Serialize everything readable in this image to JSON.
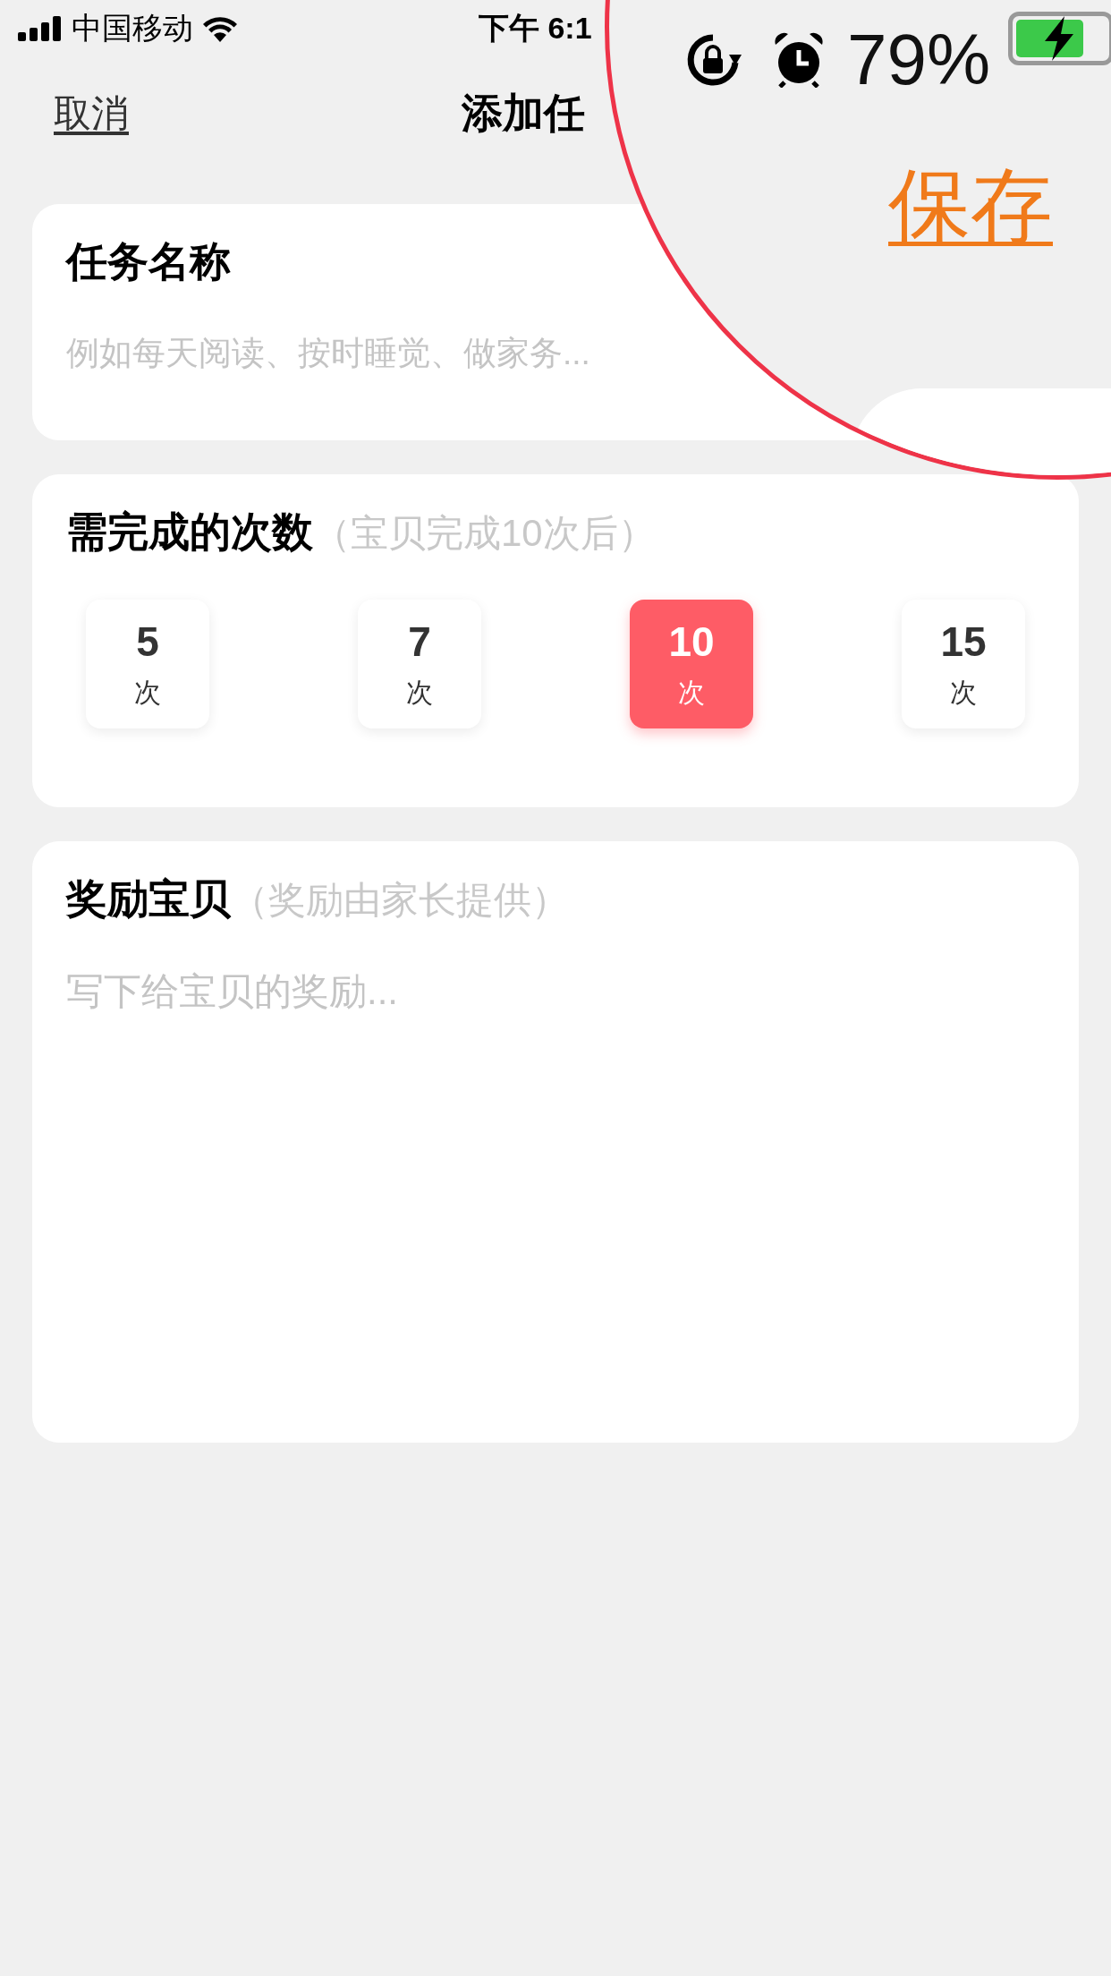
{
  "status_bar": {
    "carrier": "中国移动",
    "time": "下午 6:1"
  },
  "magnifier": {
    "battery_percent": "79%",
    "save": "保存"
  },
  "nav_bar": {
    "cancel": "取消",
    "title": "添加任"
  },
  "task_name": {
    "label": "任务名称",
    "placeholder": "例如每天阅读、按时睡觉、做家务..."
  },
  "count": {
    "label": "需完成的次数",
    "hint": "（宝贝完成10次后）",
    "options": [
      {
        "number": "5",
        "unit": "次",
        "selected": false
      },
      {
        "number": "7",
        "unit": "次",
        "selected": false
      },
      {
        "number": "10",
        "unit": "次",
        "selected": true
      },
      {
        "number": "15",
        "unit": "次",
        "selected": false
      }
    ]
  },
  "reward": {
    "label": "奖励宝贝",
    "hint": "（奖励由家长提供）",
    "placeholder": "写下给宝贝的奖励..."
  }
}
